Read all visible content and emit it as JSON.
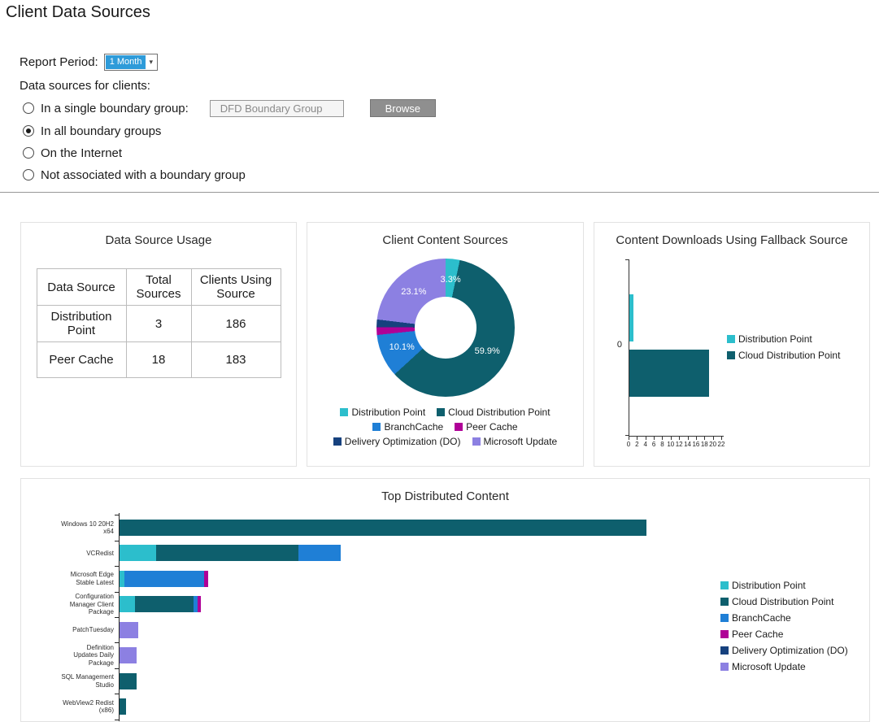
{
  "page": {
    "title": "Client Data Sources"
  },
  "filters": {
    "report_period_label": "Report Period:",
    "report_period_value": "1 Month",
    "data_sources_label": "Data sources for clients:",
    "options": [
      {
        "label": "In a single boundary group:",
        "selected": false
      },
      {
        "label": "In all boundary groups",
        "selected": true
      },
      {
        "label": "On the Internet",
        "selected": false
      },
      {
        "label": "Not associated with a boundary group",
        "selected": false
      }
    ],
    "boundary_group_input": "DFD Boundary Group",
    "browse_button": "Browse"
  },
  "usage_panel": {
    "title": "Data Source Usage",
    "headers": [
      "Data Source",
      "Total Sources",
      "Clients Using Source"
    ],
    "rows": [
      [
        "Distribution Point",
        "3",
        "186"
      ],
      [
        "Peer Cache",
        "18",
        "183"
      ]
    ]
  },
  "colors": {
    "distribution_point": "#2CBECC",
    "cloud_distribution_point": "#0E5F6D",
    "branchcache": "#1F7FD6",
    "peer_cache": "#AF0097",
    "delivery_optimization": "#16417E",
    "microsoft_update": "#8C80E2"
  },
  "chart_data": [
    {
      "type": "pie",
      "subtype": "donut",
      "title": "Client Content Sources",
      "slices": [
        {
          "name": "Distribution Point",
          "value": 3.3,
          "label": "3.3%",
          "color": "#2CBECC"
        },
        {
          "name": "Cloud Distribution Point",
          "value": 59.9,
          "label": "59.9%",
          "color": "#0E5F6D"
        },
        {
          "name": "BranchCache",
          "value": 10.1,
          "label": "10.1%",
          "color": "#1F7FD6"
        },
        {
          "name": "Peer Cache",
          "value": 1.8,
          "label": "",
          "color": "#AF0097"
        },
        {
          "name": "Delivery Optimization (DO)",
          "value": 1.8,
          "label": "",
          "color": "#16417E"
        },
        {
          "name": "Microsoft Update",
          "value": 23.1,
          "label": "23.1%",
          "color": "#8C80E2"
        }
      ],
      "legend": [
        {
          "label": "Distribution Point",
          "color": "#2CBECC"
        },
        {
          "label": "Cloud Distribution Point",
          "color": "#0E5F6D"
        },
        {
          "label": "BranchCache",
          "color": "#1F7FD6"
        },
        {
          "label": "Peer Cache",
          "color": "#AF0097"
        },
        {
          "label": "Delivery Optimization (DO)",
          "color": "#16417E"
        },
        {
          "label": "Microsoft Update",
          "color": "#8C80E2"
        }
      ],
      "legend_position": "bottom"
    },
    {
      "type": "bar",
      "orientation": "horizontal",
      "title": "Content Downloads Using Fallback Source",
      "categories": [
        "0"
      ],
      "series": [
        {
          "name": "Distribution Point",
          "color": "#2CBECC",
          "values": [
            1
          ]
        },
        {
          "name": "Cloud Distribution Point",
          "color": "#0E5F6D",
          "values": [
            19
          ]
        }
      ],
      "xlim": [
        0,
        22
      ],
      "x_ticks": [
        0,
        2,
        4,
        6,
        8,
        10,
        12,
        14,
        16,
        18,
        20,
        22
      ],
      "legend": [
        {
          "label": "Distribution Point",
          "color": "#2CBECC"
        },
        {
          "label": "Cloud Distribution Point",
          "color": "#0E5F6D"
        }
      ],
      "legend_position": "right",
      "grid": false
    },
    {
      "type": "bar",
      "stacked": true,
      "orientation": "horizontal",
      "title": "Top Distributed Content",
      "categories": [
        [
          "Windows 10 20H2",
          "x64"
        ],
        [
          "VCRedist"
        ],
        [
          "Microsoft Edge",
          "Stable Latest"
        ],
        [
          "Configuration",
          "Manager Client",
          "Package"
        ],
        [
          "PatchTuesday"
        ],
        [
          "Definition",
          "Updates Daily",
          "Package"
        ],
        [
          "SQL Management",
          "Studio"
        ],
        [
          "WebView2 Redist",
          "(x86)"
        ]
      ],
      "xlim": [
        0,
        108
      ],
      "series": [
        {
          "name": "Distribution Point",
          "color": "#2CBECC",
          "values": [
            0,
            7,
            1,
            3,
            0,
            0,
            0,
            0
          ]
        },
        {
          "name": "Cloud Distribution Point",
          "color": "#0E5F6D",
          "values": [
            100,
            27,
            0,
            11,
            0,
            0,
            3.2,
            1.2
          ]
        },
        {
          "name": "BranchCache",
          "color": "#1F7FD6",
          "values": [
            0,
            8,
            15,
            0.8,
            0,
            0,
            0,
            0
          ]
        },
        {
          "name": "Peer Cache",
          "color": "#AF0097",
          "values": [
            0,
            0,
            0.8,
            0.6,
            0,
            0,
            0,
            0
          ]
        },
        {
          "name": "Delivery Optimization (DO)",
          "color": "#16417E",
          "values": [
            0,
            0,
            0,
            0,
            0,
            0,
            0,
            0
          ]
        },
        {
          "name": "Microsoft Update",
          "color": "#8C80E2",
          "values": [
            0,
            0,
            0,
            0,
            3.5,
            3.2,
            0,
            0
          ]
        }
      ],
      "legend": [
        {
          "label": "Distribution Point",
          "color": "#2CBECC"
        },
        {
          "label": "Cloud Distribution Point",
          "color": "#0E5F6D"
        },
        {
          "label": "BranchCache",
          "color": "#1F7FD6"
        },
        {
          "label": "Peer Cache",
          "color": "#AF0097"
        },
        {
          "label": "Delivery Optimization (DO)",
          "color": "#16417E"
        },
        {
          "label": "Microsoft Update",
          "color": "#8C80E2"
        }
      ],
      "legend_position": "right",
      "grid": false
    }
  ]
}
